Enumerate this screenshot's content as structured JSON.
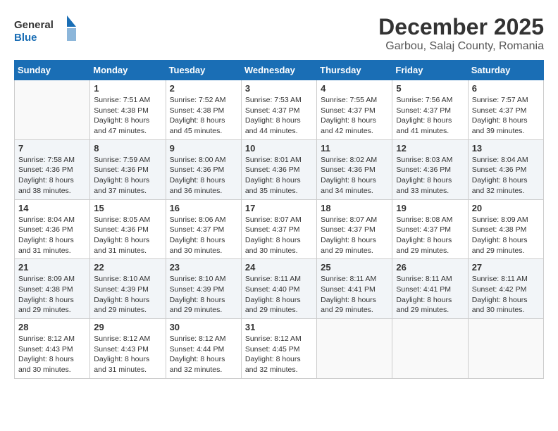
{
  "header": {
    "logo_general": "General",
    "logo_blue": "Blue",
    "month": "December 2025",
    "location": "Garbou, Salaj County, Romania"
  },
  "weekdays": [
    "Sunday",
    "Monday",
    "Tuesday",
    "Wednesday",
    "Thursday",
    "Friday",
    "Saturday"
  ],
  "weeks": [
    [
      {
        "day": "",
        "empty": true
      },
      {
        "day": "1",
        "sunrise": "7:51 AM",
        "sunset": "4:38 PM",
        "daylight": "8 hours and 47 minutes."
      },
      {
        "day": "2",
        "sunrise": "7:52 AM",
        "sunset": "4:38 PM",
        "daylight": "8 hours and 45 minutes."
      },
      {
        "day": "3",
        "sunrise": "7:53 AM",
        "sunset": "4:37 PM",
        "daylight": "8 hours and 44 minutes."
      },
      {
        "day": "4",
        "sunrise": "7:55 AM",
        "sunset": "4:37 PM",
        "daylight": "8 hours and 42 minutes."
      },
      {
        "day": "5",
        "sunrise": "7:56 AM",
        "sunset": "4:37 PM",
        "daylight": "8 hours and 41 minutes."
      },
      {
        "day": "6",
        "sunrise": "7:57 AM",
        "sunset": "4:37 PM",
        "daylight": "8 hours and 39 minutes."
      }
    ],
    [
      {
        "day": "7",
        "sunrise": "7:58 AM",
        "sunset": "4:36 PM",
        "daylight": "8 hours and 38 minutes."
      },
      {
        "day": "8",
        "sunrise": "7:59 AM",
        "sunset": "4:36 PM",
        "daylight": "8 hours and 37 minutes."
      },
      {
        "day": "9",
        "sunrise": "8:00 AM",
        "sunset": "4:36 PM",
        "daylight": "8 hours and 36 minutes."
      },
      {
        "day": "10",
        "sunrise": "8:01 AM",
        "sunset": "4:36 PM",
        "daylight": "8 hours and 35 minutes."
      },
      {
        "day": "11",
        "sunrise": "8:02 AM",
        "sunset": "4:36 PM",
        "daylight": "8 hours and 34 minutes."
      },
      {
        "day": "12",
        "sunrise": "8:03 AM",
        "sunset": "4:36 PM",
        "daylight": "8 hours and 33 minutes."
      },
      {
        "day": "13",
        "sunrise": "8:04 AM",
        "sunset": "4:36 PM",
        "daylight": "8 hours and 32 minutes."
      }
    ],
    [
      {
        "day": "14",
        "sunrise": "8:04 AM",
        "sunset": "4:36 PM",
        "daylight": "8 hours and 31 minutes."
      },
      {
        "day": "15",
        "sunrise": "8:05 AM",
        "sunset": "4:36 PM",
        "daylight": "8 hours and 31 minutes."
      },
      {
        "day": "16",
        "sunrise": "8:06 AM",
        "sunset": "4:37 PM",
        "daylight": "8 hours and 30 minutes."
      },
      {
        "day": "17",
        "sunrise": "8:07 AM",
        "sunset": "4:37 PM",
        "daylight": "8 hours and 30 minutes."
      },
      {
        "day": "18",
        "sunrise": "8:07 AM",
        "sunset": "4:37 PM",
        "daylight": "8 hours and 29 minutes."
      },
      {
        "day": "19",
        "sunrise": "8:08 AM",
        "sunset": "4:37 PM",
        "daylight": "8 hours and 29 minutes."
      },
      {
        "day": "20",
        "sunrise": "8:09 AM",
        "sunset": "4:38 PM",
        "daylight": "8 hours and 29 minutes."
      }
    ],
    [
      {
        "day": "21",
        "sunrise": "8:09 AM",
        "sunset": "4:38 PM",
        "daylight": "8 hours and 29 minutes."
      },
      {
        "day": "22",
        "sunrise": "8:10 AM",
        "sunset": "4:39 PM",
        "daylight": "8 hours and 29 minutes."
      },
      {
        "day": "23",
        "sunrise": "8:10 AM",
        "sunset": "4:39 PM",
        "daylight": "8 hours and 29 minutes."
      },
      {
        "day": "24",
        "sunrise": "8:11 AM",
        "sunset": "4:40 PM",
        "daylight": "8 hours and 29 minutes."
      },
      {
        "day": "25",
        "sunrise": "8:11 AM",
        "sunset": "4:41 PM",
        "daylight": "8 hours and 29 minutes."
      },
      {
        "day": "26",
        "sunrise": "8:11 AM",
        "sunset": "4:41 PM",
        "daylight": "8 hours and 29 minutes."
      },
      {
        "day": "27",
        "sunrise": "8:11 AM",
        "sunset": "4:42 PM",
        "daylight": "8 hours and 30 minutes."
      }
    ],
    [
      {
        "day": "28",
        "sunrise": "8:12 AM",
        "sunset": "4:43 PM",
        "daylight": "8 hours and 30 minutes."
      },
      {
        "day": "29",
        "sunrise": "8:12 AM",
        "sunset": "4:43 PM",
        "daylight": "8 hours and 31 minutes."
      },
      {
        "day": "30",
        "sunrise": "8:12 AM",
        "sunset": "4:44 PM",
        "daylight": "8 hours and 32 minutes."
      },
      {
        "day": "31",
        "sunrise": "8:12 AM",
        "sunset": "4:45 PM",
        "daylight": "8 hours and 32 minutes."
      },
      {
        "day": "",
        "empty": true
      },
      {
        "day": "",
        "empty": true
      },
      {
        "day": "",
        "empty": true
      }
    ]
  ]
}
